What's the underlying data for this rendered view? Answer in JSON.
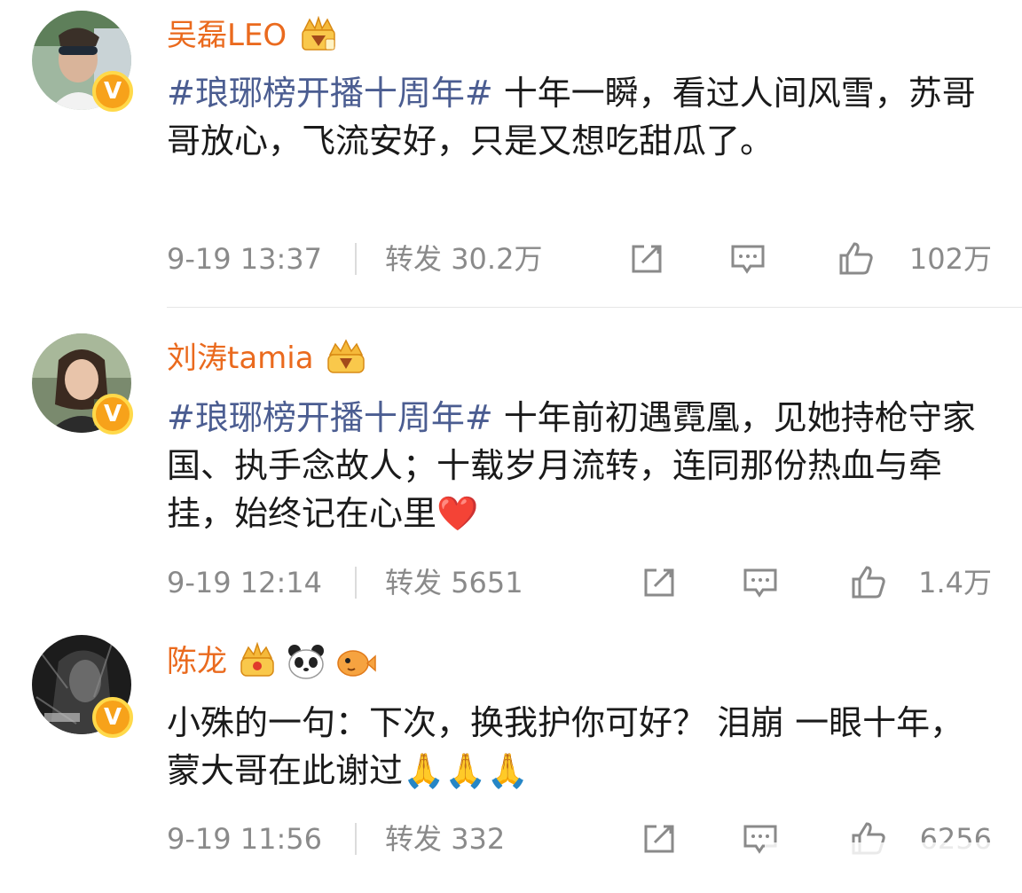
{
  "posts": [
    {
      "username": "吴磊LEO",
      "badge_letter": "V",
      "hashtag": "#琅琊榜开播十周年#",
      "text": " 十年一瞬，看过人间风雪，苏哥哥放心，飞流安好，只是又想吃甜瓜了。",
      "time": "9-19 13:37",
      "repost_label": "转发",
      "repost_count": "30.2万",
      "like_count": "102万"
    },
    {
      "username": "刘涛tamia",
      "badge_letter": "V",
      "hashtag": "#琅琊榜开播十周年#",
      "text": " 十年前初遇霓凰，见她持枪守家国、执手念故人；十载岁月流转，连同那份热血与牵挂，始终记在心里❤️",
      "time": "9-19 12:14",
      "repost_label": "转发",
      "repost_count": "5651",
      "like_count": "1.4万"
    },
    {
      "username": "陈龙",
      "badge_letter": "V",
      "hashtag": "",
      "text": "小殊的一句：下次，换我护你可好？ 泪崩 一眼十年，蒙大哥在此谢过🙏🙏🙏",
      "time": "9-19 11:56",
      "repost_label": "转发",
      "repost_count": "332",
      "like_count": "6256"
    }
  ],
  "colors": {
    "username": "#ea6a1e",
    "hashtag": "#4b5d91",
    "meta": "#8a8a8a",
    "badge": "#f7a21a"
  },
  "icons": [
    "share-icon",
    "comment-icon",
    "thumbs-up-icon",
    "crown-emblem-icon",
    "panda-icon",
    "pufferfish-icon"
  ]
}
